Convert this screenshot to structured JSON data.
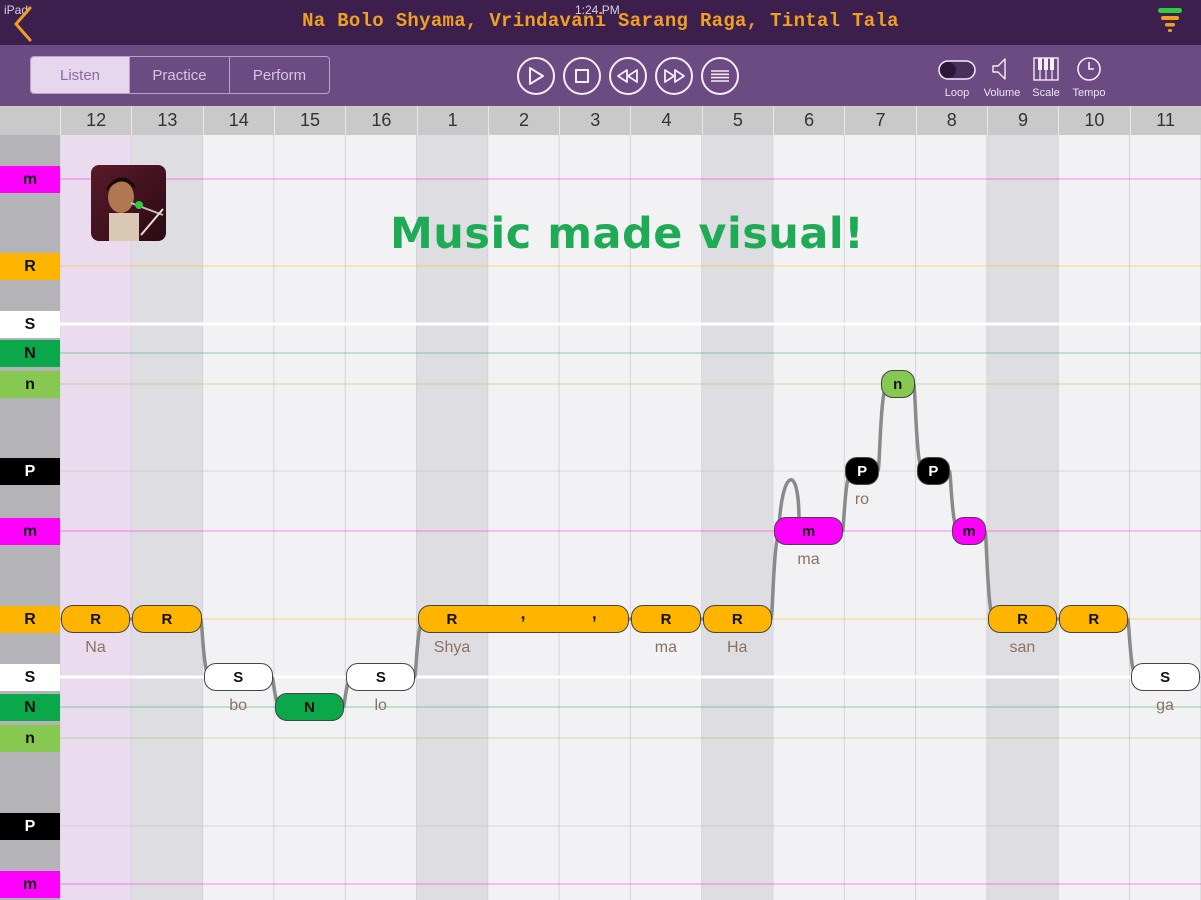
{
  "status": {
    "left": "iPad",
    "time": "1:24 PM"
  },
  "title": "Na Bolo Shyama, Vrindavani Sarang Raga, Tintal Tala",
  "mode_tabs": [
    {
      "label": "Listen",
      "active": true
    },
    {
      "label": "Practice",
      "active": false
    },
    {
      "label": "Perform",
      "active": false
    }
  ],
  "controls": {
    "loop": "Loop",
    "volume": "Volume",
    "scale": "Scale",
    "tempo": "Tempo"
  },
  "beats": [
    "12",
    "13",
    "14",
    "15",
    "16",
    "1",
    "2",
    "3",
    "4",
    "5",
    "6",
    "7",
    "8",
    "9",
    "10",
    "11"
  ],
  "tagline": "Music made visual!",
  "swara_labels": [
    {
      "text": "m",
      "bg": "#ff00ff",
      "fg": "#111111"
    },
    {
      "text": "R",
      "bg": "#ffb400",
      "fg": "#111111"
    },
    {
      "text": "S",
      "bg": "#ffffff",
      "fg": "#111111"
    },
    {
      "text": "N",
      "bg": "#0aa84a",
      "fg": "#111111"
    },
    {
      "text": "n",
      "bg": "#86c850",
      "fg": "#111111"
    },
    {
      "text": "P",
      "bg": "#000000",
      "fg": "#ffffff"
    },
    {
      "text": "m",
      "bg": "#ff00ff",
      "fg": "#111111"
    },
    {
      "text": "R",
      "bg": "#ffb400",
      "fg": "#111111"
    },
    {
      "text": "S",
      "bg": "#ffffff",
      "fg": "#111111"
    },
    {
      "text": "N",
      "bg": "#0aa84a",
      "fg": "#111111"
    },
    {
      "text": "n",
      "bg": "#86c850",
      "fg": "#111111"
    },
    {
      "text": "P",
      "bg": "#000000",
      "fg": "#ffffff"
    },
    {
      "text": "m",
      "bg": "#ff00ff",
      "fg": "#111111"
    }
  ],
  "notes": [
    {
      "swara": "R",
      "lyric": "Na"
    },
    {
      "swara": "R",
      "lyric": ""
    },
    {
      "swara": "S",
      "lyric": "bo"
    },
    {
      "swara": "N",
      "lyric": ""
    },
    {
      "swara": "S",
      "lyric": "lo"
    },
    {
      "swara": "R",
      "lyric": "Shya"
    },
    {
      "swara": "R",
      "lyric": "ma"
    },
    {
      "swara": "R",
      "lyric": "Ha"
    },
    {
      "swara": "m",
      "lyric": "ma"
    },
    {
      "swara": "P",
      "lyric": "ro"
    },
    {
      "swara": "n",
      "lyric": ""
    },
    {
      "swara": "P",
      "lyric": ""
    },
    {
      "swara": "m",
      "lyric": ""
    },
    {
      "swara": "R",
      "lyric": "san"
    },
    {
      "swara": "R",
      "lyric": ""
    },
    {
      "swara": "S",
      "lyric": "ga"
    }
  ],
  "hold_marks": [
    ",",
    ","
  ],
  "colors": {
    "header_bg": "#3d1f4e",
    "toolbar_bg": "#6c4a82",
    "title": "#f0a020",
    "tagline": "#1faa55"
  }
}
